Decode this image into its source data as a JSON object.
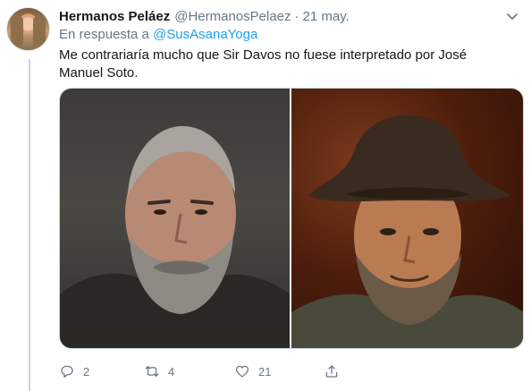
{
  "tweet": {
    "display_name": "Hermanos Peláez",
    "handle": "@HermanosPelaez",
    "separator": "·",
    "date": "21 may.",
    "reply_prefix": "En respuesta a",
    "reply_mention": "@SusAsanaYoga",
    "text": "Me contrariaría mucho que Sir Davos no fuese interpretado por José Manuel Soto."
  },
  "actions": {
    "replies": "2",
    "retweets": "4",
    "likes": "21"
  },
  "icons": {
    "more": "chevron-down-icon",
    "reply": "speech-bubble-icon",
    "retweet": "retweet-arrows-icon",
    "like": "heart-icon",
    "share": "share-upload-icon"
  },
  "colors": {
    "link": "#1da1f2",
    "secondary_text": "#657786",
    "primary_text": "#14171a",
    "thread_line": "#ccd6dd"
  }
}
